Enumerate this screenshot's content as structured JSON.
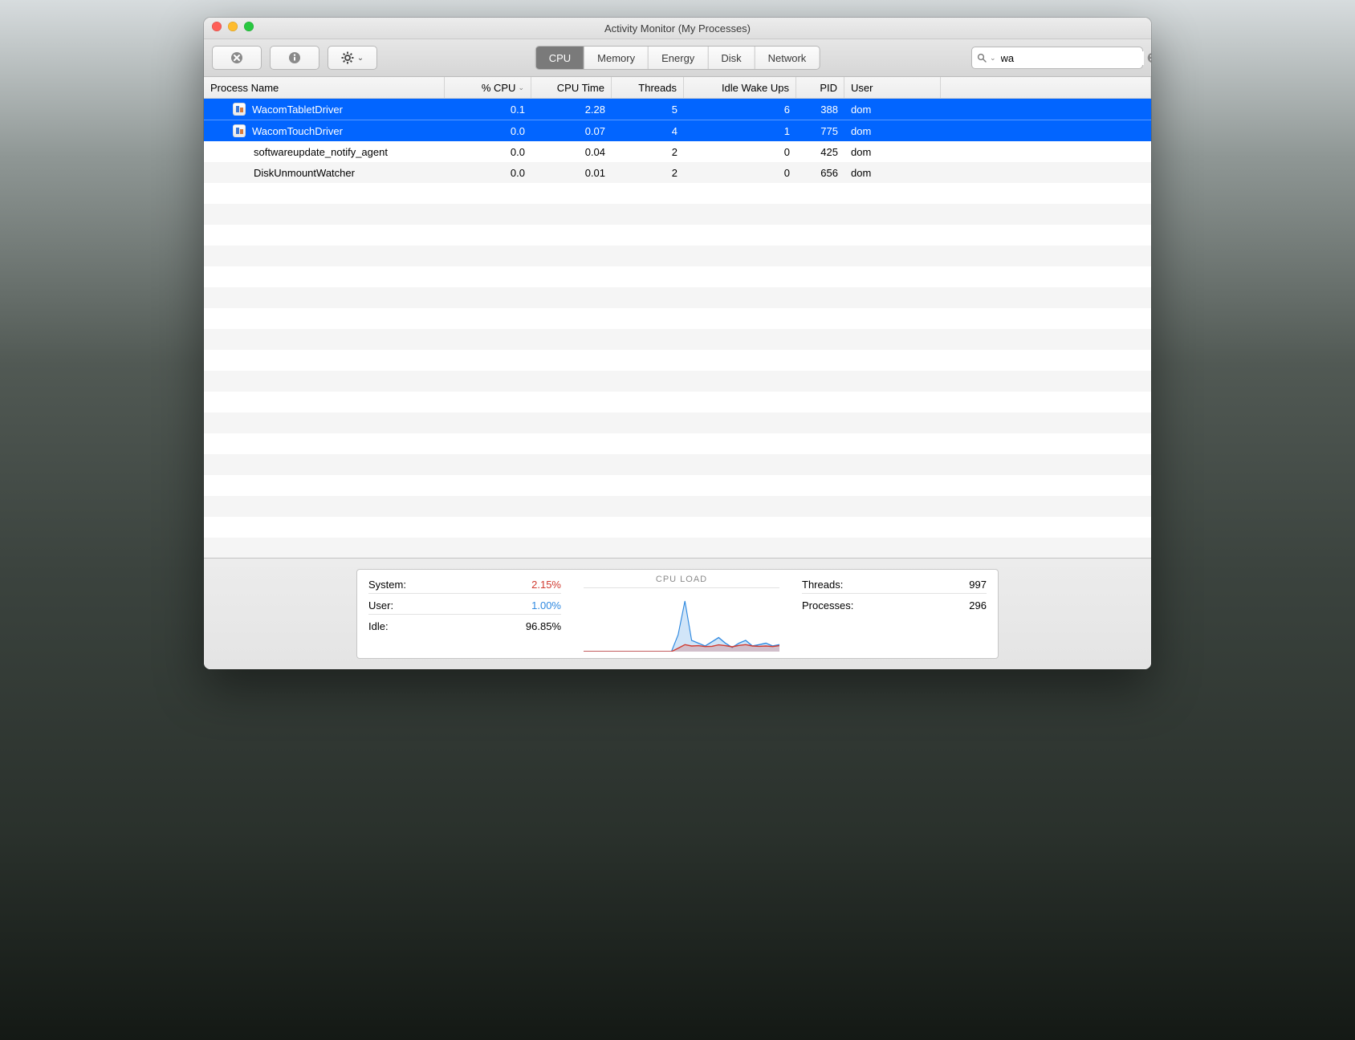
{
  "window": {
    "title": "Activity Monitor (My Processes)"
  },
  "toolbar": {
    "stop_label": "Stop Process",
    "info_label": "Inspect Process",
    "gear_label": "Options",
    "tabs": [
      "CPU",
      "Memory",
      "Energy",
      "Disk",
      "Network"
    ],
    "active_tab_index": 0,
    "search_value": "wa",
    "search_placeholder": ""
  },
  "columns": {
    "name": "Process Name",
    "cpu": "% CPU",
    "time": "CPU Time",
    "threads": "Threads",
    "idle": "Idle Wake Ups",
    "pid": "PID",
    "user": "User",
    "sort_column": "cpu",
    "sort_dir": "desc",
    "sort_glyph": "⌄"
  },
  "processes": [
    {
      "name": "WacomTabletDriver",
      "cpu": "0.1",
      "time": "2.28",
      "threads": "5",
      "idle": "6",
      "pid": "388",
      "user": "dom",
      "selected": true,
      "has_icon": true
    },
    {
      "name": "WacomTouchDriver",
      "cpu": "0.0",
      "time": "0.07",
      "threads": "4",
      "idle": "1",
      "pid": "775",
      "user": "dom",
      "selected": true,
      "has_icon": true
    },
    {
      "name": "softwareupdate_notify_agent",
      "cpu": "0.0",
      "time": "0.04",
      "threads": "2",
      "idle": "0",
      "pid": "425",
      "user": "dom",
      "selected": false,
      "has_icon": false
    },
    {
      "name": "DiskUnmountWatcher",
      "cpu": "0.0",
      "time": "0.01",
      "threads": "2",
      "idle": "0",
      "pid": "656",
      "user": "dom",
      "selected": false,
      "has_icon": false
    }
  ],
  "empty_rows": 18,
  "footer": {
    "stats": [
      {
        "label": "System:",
        "value": "2.15%",
        "klass": "red"
      },
      {
        "label": "User:",
        "value": "1.00%",
        "klass": "blue"
      },
      {
        "label": "Idle:",
        "value": "96.85%",
        "klass": ""
      }
    ],
    "chart_label": "CPU LOAD",
    "right": [
      {
        "label": "Threads:",
        "value": "997"
      },
      {
        "label": "Processes:",
        "value": "296"
      }
    ]
  },
  "chart_data": {
    "type": "area",
    "title": "CPU LOAD",
    "xlabel": "",
    "ylabel": "",
    "x": [
      0,
      1,
      2,
      3,
      4,
      5,
      6,
      7,
      8,
      9,
      10,
      11,
      12,
      13,
      14,
      15,
      16,
      17,
      18,
      19,
      20,
      21,
      22,
      23,
      24,
      25,
      26,
      27,
      28,
      29
    ],
    "series": [
      {
        "name": "System",
        "color": "#d13a2f",
        "values": [
          0,
          0,
          0,
          0,
          0,
          0,
          0,
          0,
          0,
          0,
          0,
          0,
          0,
          0,
          1.2,
          2.5,
          2.0,
          2.1,
          1.8,
          1.9,
          2.4,
          2.1,
          1.7,
          2.2,
          2.5,
          2.0,
          1.9,
          2.0,
          1.8,
          2.1
        ]
      },
      {
        "name": "User",
        "color": "#2f89e0",
        "values": [
          0,
          0,
          0,
          0,
          0,
          0,
          0,
          0,
          0,
          0,
          0,
          0,
          0,
          0,
          6.0,
          18,
          4.0,
          3.0,
          2.0,
          3.5,
          5.0,
          3.0,
          1.5,
          3.0,
          4.0,
          2.0,
          2.5,
          3.0,
          2.0,
          2.5
        ]
      }
    ],
    "ylim": [
      0,
      20
    ]
  }
}
